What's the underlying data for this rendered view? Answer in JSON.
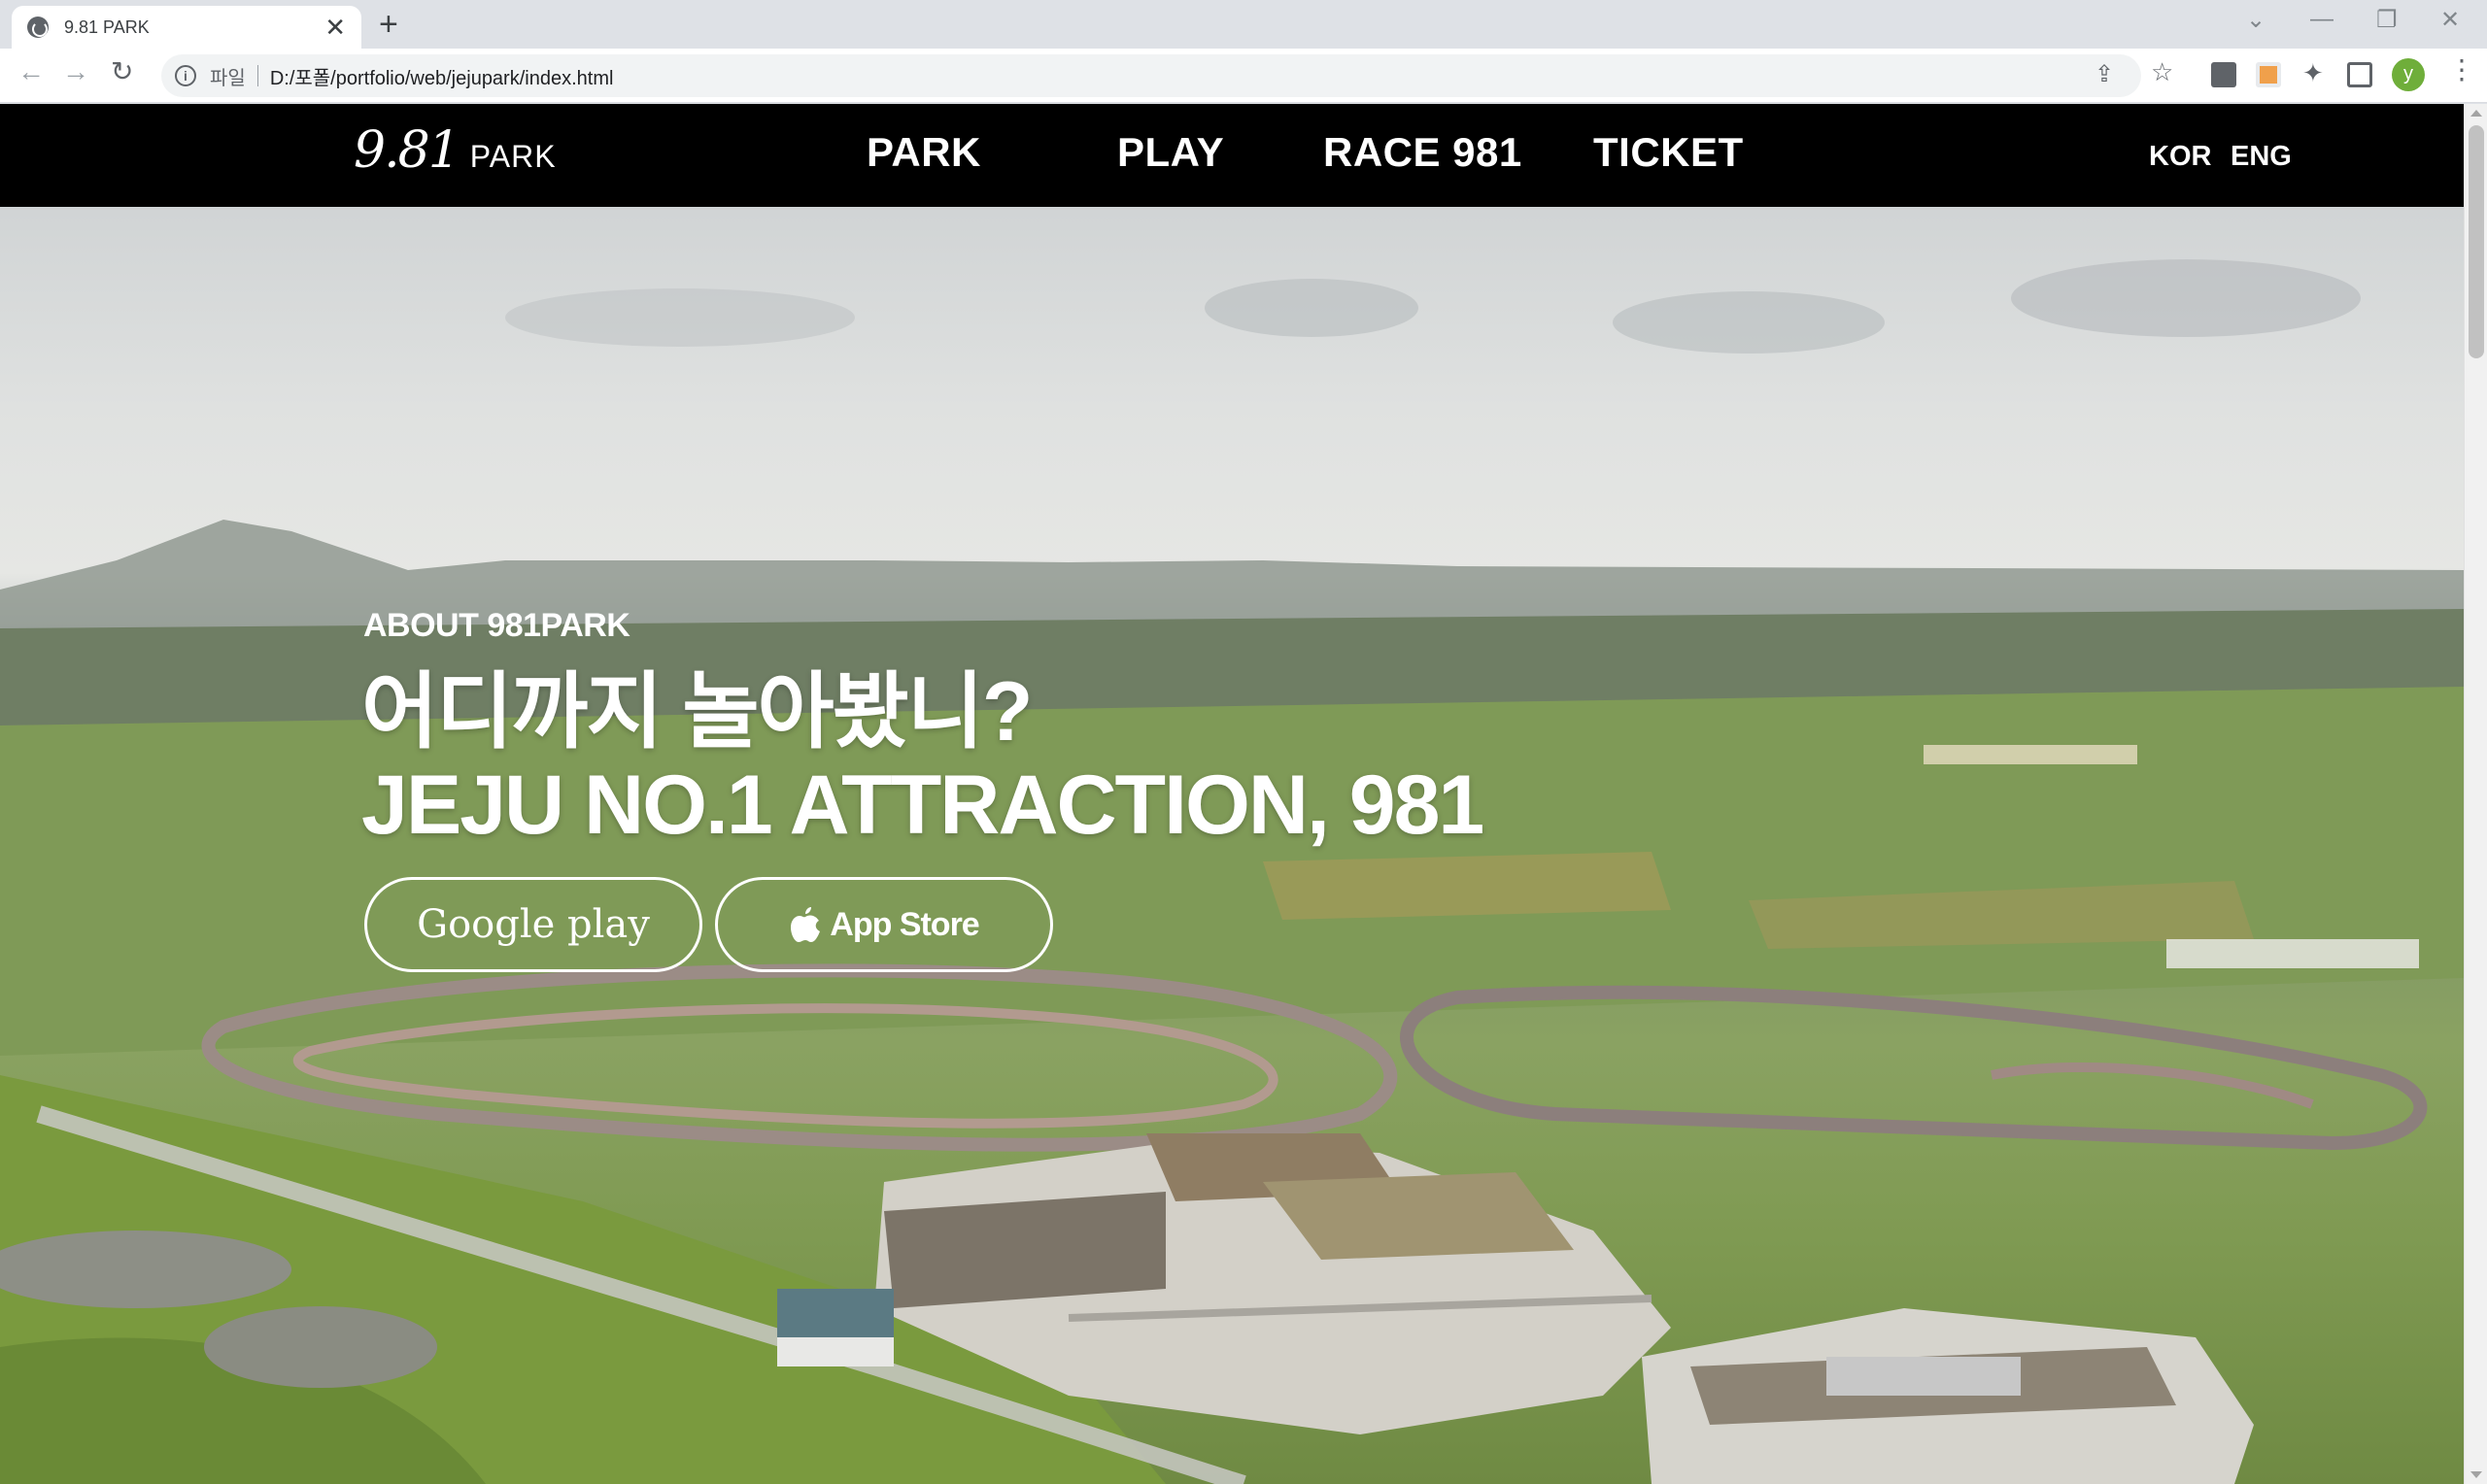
{
  "browser": {
    "tab_title": "9.81 PARK",
    "tab_close": "✕",
    "new_tab": "+",
    "scheme_label": "파일",
    "url": "D:/포폴/portfolio/web/jejupark/index.html",
    "profile_initial": "y"
  },
  "site": {
    "logo": {
      "number": "9.81",
      "word": "PARK"
    },
    "nav": [
      "PARK",
      "PLAY",
      "RACE 981",
      "TICKET"
    ],
    "lang": [
      "KOR",
      "ENG"
    ]
  },
  "hero": {
    "label": "ABOUT 981PARK",
    "headline_line1": "어디까지 놀아봤니?",
    "headline_line2": "JEJU NO.1 ATTRACTION, 981",
    "google_button": "Google play",
    "apple_button": "App Store"
  },
  "colors": {
    "header_bg": "#000000",
    "text": "#ffffff",
    "browser_chrome": "#dee1e6",
    "profile": "#6fae3a"
  },
  "icons": [
    "globe-icon",
    "close-icon",
    "plus-icon",
    "back-icon",
    "forward-icon",
    "reload-icon",
    "info-icon",
    "share-icon",
    "star-icon",
    "extension-icon",
    "puzzle-icon",
    "side-panel-icon",
    "menu-icon",
    "apple-icon"
  ]
}
